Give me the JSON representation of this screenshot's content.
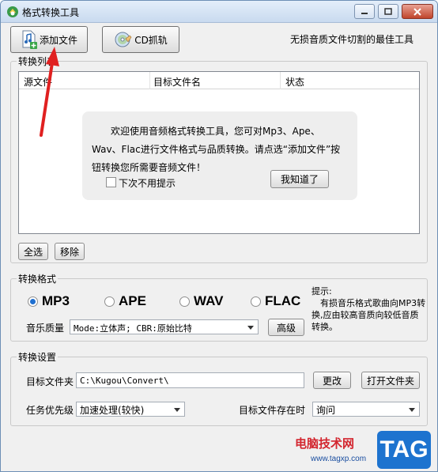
{
  "window": {
    "title": "格式转换工具"
  },
  "toolbar": {
    "add_file_label": "添加文件",
    "cd_rip_label": "CD抓轨",
    "tagline": "无损音质文件切割的最佳工具"
  },
  "convert_list": {
    "group_title": "转换列表",
    "columns": [
      "源文件",
      "目标文件名",
      "状态"
    ],
    "welcome": {
      "message": "欢迎使用音频格式转换工具，您可对Mp3、Ape、Wav、Flac进行文件格式与品质转换。请点选“添加文件”按钮转换您所需要音频文件！",
      "dont_show_label": "下次不用提示",
      "dont_show_checked": false,
      "got_it_label": "我知道了"
    },
    "select_all_label": "全选",
    "remove_label": "移除"
  },
  "format": {
    "group_title": "转换格式",
    "options": [
      "MP3",
      "APE",
      "WAV",
      "FLAC"
    ],
    "selected": "MP3",
    "quality_label": "音乐质量",
    "quality_value": "Mode:立体声; CBR:原始比特",
    "advanced_label": "高级",
    "hint_title": "提示:",
    "hint_text": "有损音乐格式歌曲向MP3转换,应由较高音质向较低音质转换。"
  },
  "settings": {
    "group_title": "转换设置",
    "target_folder_label": "目标文件夹",
    "target_folder_value": "C:\\Kugou\\Convert\\",
    "change_label": "更改",
    "open_folder_label": "打开文件夹",
    "priority_label": "任务优先级",
    "priority_value": "加速处理(较快)",
    "exists_label": "目标文件存在时",
    "exists_value": "询问"
  },
  "watermark": {
    "site_name": "电脑技术网",
    "site_url": "www.tagxp.com",
    "badge": "TAG"
  },
  "colors": {
    "accent": "#1f6fd0",
    "arrow": "#e02020",
    "watermark_red": "#d3262f",
    "badge_blue": "#1d73cf"
  }
}
